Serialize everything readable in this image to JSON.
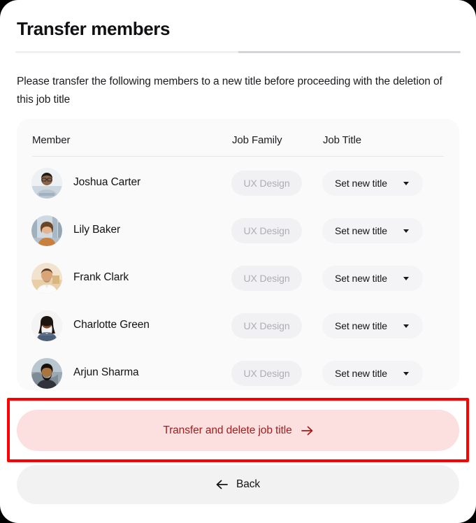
{
  "page": {
    "title": "Transfer members",
    "description": "Please transfer the following members to a new title before proceeding with the deletion of this job title"
  },
  "progress": {
    "completed_pct": 50,
    "track_color_done": "#f0f0f2",
    "track_color_rest": "#d3d3db"
  },
  "table": {
    "columns": [
      "Member",
      "Job Family",
      "Job Title"
    ],
    "rows": [
      {
        "name": "Joshua Carter",
        "job_family": "UX Design",
        "job_title_action": "Set new title",
        "avatar": "photo-man-glasses-arms-crossed"
      },
      {
        "name": "Lily Baker",
        "job_family": "UX Design",
        "job_title_action": "Set new title",
        "avatar": "photo-woman-city-background"
      },
      {
        "name": "Frank Clark",
        "job_family": "UX Design",
        "job_title_action": "Set new title",
        "avatar": "photo-man-white-shirt-sunset"
      },
      {
        "name": "Charlotte Green",
        "job_family": "UX Design",
        "job_title_action": "Set new title",
        "avatar": "photo-woman-braids-arms-crossed"
      },
      {
        "name": "Arjun Sharma",
        "job_family": "UX Design",
        "job_title_action": "Set new title",
        "avatar": "photo-man-beard-outdoors"
      }
    ]
  },
  "actions": {
    "primary_label": "Transfer and delete job title",
    "primary_icon": "arrow-right-icon",
    "primary_bg": "#fcdfdf",
    "primary_fg": "#a31d1d",
    "back_label": "Back",
    "back_icon": "arrow-left-icon",
    "back_bg": "#f2f2f3"
  },
  "highlight": {
    "target": "primary_action_button",
    "color": "#fe0000"
  },
  "icons": {
    "caret": "chevron-down-icon"
  }
}
